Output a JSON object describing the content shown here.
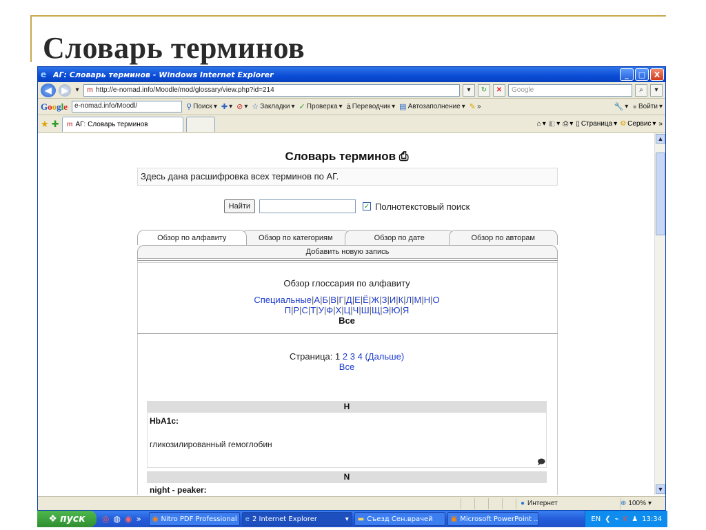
{
  "slide": {
    "title": "Словарь терминов"
  },
  "window": {
    "title": "АГ: Словарь терминов - Windows Internet Explorer",
    "controls": {
      "minimize": "_",
      "maximize": "□",
      "close": "X"
    }
  },
  "address": {
    "url": "http://e-nomad.info/Moodle/mod/glossary/view.php?id=214",
    "search_placeholder": "Google"
  },
  "googlebar": {
    "logo": [
      "G",
      "o",
      "o",
      "g",
      "l",
      "e"
    ],
    "input_value": "e-nomad.info/Moodl/",
    "search": "Поиск",
    "bookmarks": "Закладки",
    "spellcheck": "Проверка",
    "translator": "Переводчик",
    "autofill": "Автозаполнение",
    "signin": "Войти"
  },
  "tabsbar": {
    "tab_title": "АГ: Словарь терминов",
    "page_menu": "Страница",
    "tools_menu": "Сервис"
  },
  "page": {
    "heading": "Словарь терминов",
    "intro": "Здесь дана расшифровка всех терминов по АГ.",
    "find_button": "Найти",
    "fulltext_label": "Полнотекстовый поиск",
    "tabs": [
      "Обзор по алфавиту",
      "Обзор по категориям",
      "Обзор по дате",
      "Обзор по авторам"
    ],
    "add_entry": "Добавить новую запись",
    "browse_label": "Обзор глоссария по алфавиту",
    "letters_row1": [
      "Специальные",
      "А",
      "Б",
      "В",
      "Г",
      "Д",
      "Е",
      "Ё",
      "Ж",
      "З",
      "И",
      "К",
      "Л",
      "М",
      "Н",
      "О"
    ],
    "letters_row2": [
      "П",
      "Р",
      "С",
      "Т",
      "У",
      "Ф",
      "Х",
      "Ц",
      "Ч",
      "Ш",
      "Щ",
      "Э",
      "Ю",
      "Я"
    ],
    "letters_all": "Все",
    "pager_label": "Страница:",
    "pages": [
      "1",
      "2",
      "3",
      "4"
    ],
    "next": "(Дальше)",
    "pager_all": "Все",
    "sections": [
      {
        "letter": "H",
        "term": "HbA1c:",
        "definition": "гликозилированный гемоглобин"
      },
      {
        "letter": "N",
        "term": "night - peaker:"
      }
    ]
  },
  "status": {
    "zone": "Интернет",
    "zoom": "100%"
  },
  "taskbar": {
    "start": "пуск",
    "tasks": [
      "Nitro PDF Professional",
      "2 Internet Explorer",
      "Съезд Сен.врачей",
      "Microsoft PowerPoint ..."
    ],
    "lang": "EN",
    "clock": "13:34"
  },
  "colors": {
    "slide_accent": "#c8a84a",
    "titlebar": "#0a4cd6",
    "link": "#1a3acc",
    "taskbar": "#245ddb"
  }
}
